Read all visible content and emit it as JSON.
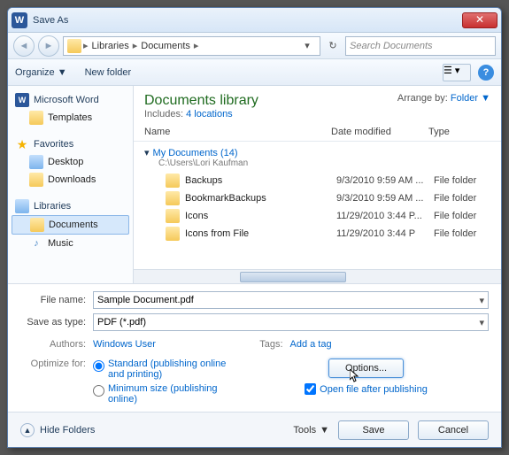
{
  "title": "Save As",
  "breadcrumb": {
    "seg1": "Libraries",
    "seg2": "Documents"
  },
  "search_placeholder": "Search Documents",
  "toolbar": {
    "organize": "Organize",
    "new_folder": "New folder"
  },
  "sidebar": {
    "word": "Microsoft Word",
    "templates": "Templates",
    "favorites": "Favorites",
    "desktop": "Desktop",
    "downloads": "Downloads",
    "libraries": "Libraries",
    "documents": "Documents",
    "music": "Music"
  },
  "library": {
    "title": "Documents library",
    "includes_prefix": "Includes:",
    "includes_link": "4 locations",
    "arrange_label": "Arrange by:",
    "arrange_value": "Folder"
  },
  "columns": {
    "name": "Name",
    "date": "Date modified",
    "type": "Type"
  },
  "group": {
    "name": "My Documents (14)",
    "path": "C:\\Users\\Lori Kaufman"
  },
  "files": [
    {
      "name": "Backups",
      "date": "9/3/2010 9:59 AM ...",
      "type": "File folder"
    },
    {
      "name": "BookmarkBackups",
      "date": "9/3/2010 9:59 AM ...",
      "type": "File folder"
    },
    {
      "name": "Icons",
      "date": "11/29/2010 3:44 P...",
      "type": "File folder"
    },
    {
      "name": "Icons from File",
      "date": "11/29/2010 3:44 P",
      "type": "File folder"
    }
  ],
  "form": {
    "filename_label": "File name:",
    "filename_value": "Sample Document.pdf",
    "savetype_label": "Save as type:",
    "savetype_value": "PDF (*.pdf)",
    "authors_label": "Authors:",
    "authors_value": "Windows User",
    "tags_label": "Tags:",
    "tags_value": "Add a tag",
    "optimize_label": "Optimize for:",
    "opt_standard": "Standard (publishing online and printing)",
    "opt_min": "Minimum size (publishing online)",
    "options_btn": "Options...",
    "open_after": "Open file after publishing"
  },
  "footer": {
    "hide": "Hide Folders",
    "tools": "Tools",
    "save": "Save",
    "cancel": "Cancel"
  }
}
